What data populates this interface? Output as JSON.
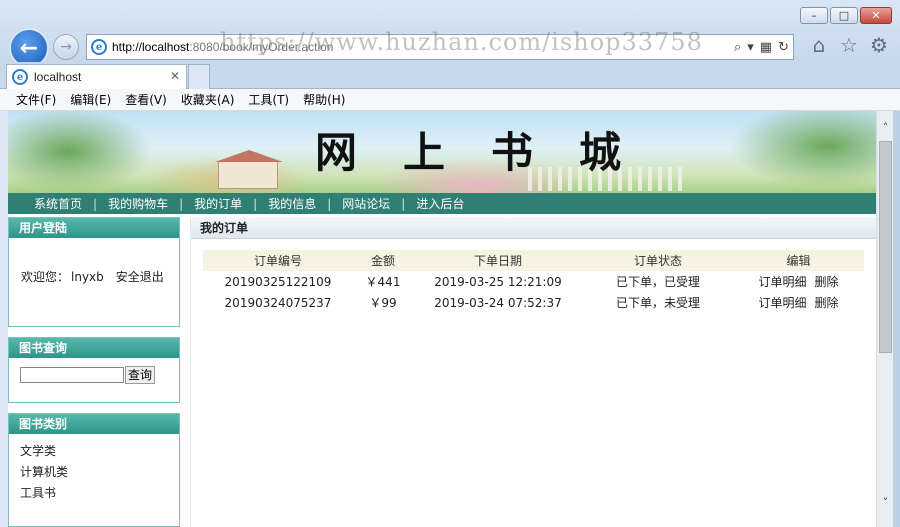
{
  "window": {
    "minimize": "–",
    "maximize": "□",
    "close": "✕"
  },
  "address": {
    "host": "http://localhost",
    "rest": ":8080/book/myOrder.action",
    "watermark": "https://www.huzhan.com/ishop33758"
  },
  "tab": {
    "title": "localhost"
  },
  "menu": [
    "文件(F)",
    "编辑(E)",
    "查看(V)",
    "收藏夹(A)",
    "工具(T)",
    "帮助(H)"
  ],
  "banner": {
    "title_chars": [
      "网",
      "上",
      "书",
      "城"
    ]
  },
  "site_nav": [
    "系统首页",
    "我的购物车",
    "我的订单",
    "我的信息",
    "网站论坛",
    "进入后台"
  ],
  "sidebar": {
    "login": {
      "title": "用户登陆",
      "welcome": "欢迎您：",
      "username": "lnyxb",
      "logout": "安全退出"
    },
    "search": {
      "title": "图书查询",
      "button": "查询",
      "value": ""
    },
    "category": {
      "title": "图书类别",
      "items": [
        "文学类",
        "计算机类",
        "工具书"
      ]
    }
  },
  "main": {
    "title": "我的订单",
    "columns": [
      "订单编号",
      "金额",
      "下单日期",
      "订单状态",
      "编辑"
    ],
    "rows": [
      {
        "id": "20190325122109",
        "amount": "￥441",
        "date": "2019-03-25 12:21:09",
        "status": "已下单，已受理",
        "detail": "订单明细",
        "delete": "删除"
      },
      {
        "id": "20190324075237",
        "amount": "￥99",
        "date": "2019-03-24 07:52:37",
        "status": "已下单，未受理",
        "detail": "订单明细",
        "delete": "删除"
      }
    ]
  },
  "colors": {
    "nav_bg": "#2f7f74",
    "panel_head": "#3aa296",
    "header_row": "#f6f3e2"
  },
  "icons": [
    "back-arrow-icon",
    "forward-arrow-icon",
    "ie-logo-icon",
    "search-icon",
    "refresh-icon",
    "home-icon",
    "favorites-star-icon",
    "gear-icon"
  ]
}
